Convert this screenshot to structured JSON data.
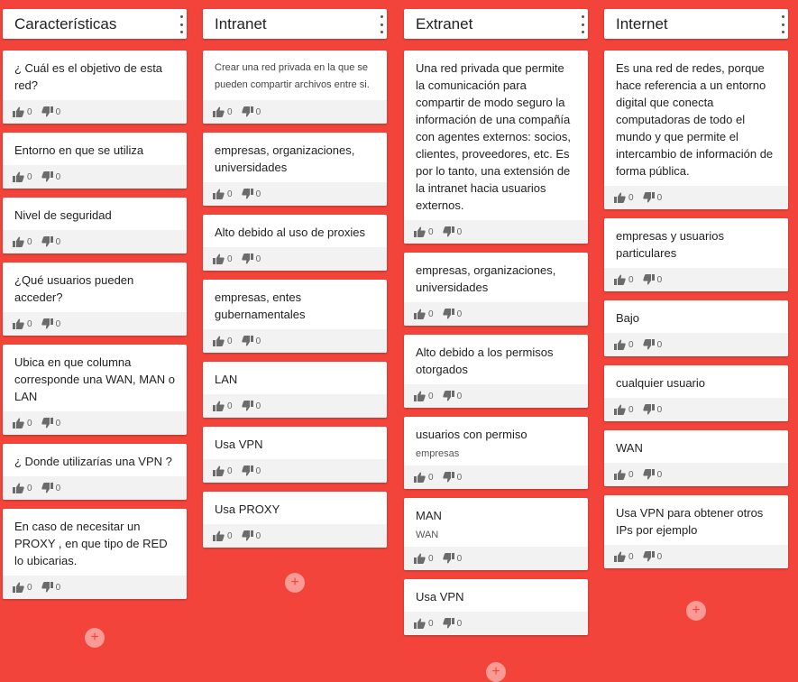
{
  "columns": [
    {
      "title": "Características",
      "cards": [
        {
          "text": "¿ Cuál es el objetivo de esta red?",
          "likes": "0",
          "dislikes": "0"
        },
        {
          "text": "Entorno en que se utiliza",
          "likes": "0",
          "dislikes": "0"
        },
        {
          "text": "Nivel de seguridad",
          "likes": "0",
          "dislikes": "0"
        },
        {
          "text": "¿Qué usuarios pueden acceder?",
          "likes": "0",
          "dislikes": "0"
        },
        {
          "text": "Ubica en que columna corresponde una WAN, MAN o LAN",
          "likes": "0",
          "dislikes": "0"
        },
        {
          "text": "¿ Donde utilizarías una VPN ?",
          "likes": "0",
          "dislikes": "0"
        },
        {
          "text": "En caso de necesitar un PROXY , en que tipo de RED lo ubicarias.",
          "likes": "0",
          "dislikes": "0"
        }
      ],
      "add_label": "+"
    },
    {
      "title": "Intranet",
      "cards": [
        {
          "text": "Crear una red privada en la que se pueden compartir archivos entre si.",
          "likes": "0",
          "dislikes": "0"
        },
        {
          "text": "empresas, organizaciones, universidades",
          "likes": "0",
          "dislikes": "0"
        },
        {
          "text": "Alto debido al uso de proxies",
          "likes": "0",
          "dislikes": "0"
        },
        {
          "text": "empresas, entes gubernamentales",
          "likes": "0",
          "dislikes": "0"
        },
        {
          "text": "LAN",
          "likes": "0",
          "dislikes": "0"
        },
        {
          "text": "Usa VPN",
          "likes": "0",
          "dislikes": "0"
        },
        {
          "text": "Usa PROXY",
          "likes": "0",
          "dislikes": "0"
        }
      ],
      "add_label": "+"
    },
    {
      "title": "Extranet",
      "cards": [
        {
          "text": "Una red privada que permite la comunicación para compartir de modo seguro la información de una compañía con agentes externos: socios, clientes, proveedores, etc. Es por lo tanto, una extensión de la intranet hacia usuarios externos.",
          "likes": "0",
          "dislikes": "0"
        },
        {
          "text": "empresas, organizaciones, universidades",
          "likes": "0",
          "dislikes": "0"
        },
        {
          "text": "Alto debido a los permisos otorgados",
          "likes": "0",
          "dislikes": "0"
        },
        {
          "text": "usuarios con permiso",
          "sub": "empresas",
          "likes": "0",
          "dislikes": "0"
        },
        {
          "text": "MAN",
          "sub": "WAN",
          "likes": "0",
          "dislikes": "0"
        },
        {
          "text": "Usa VPN",
          "likes": "0",
          "dislikes": "0"
        }
      ],
      "add_label": "+"
    },
    {
      "title": "Internet",
      "cards": [
        {
          "text": "Es una red de redes, porque hace referencia a un entorno digital que conecta computadoras de todo el mundo y que permite el intercambio de información de forma pública.",
          "likes": "0",
          "dislikes": "0"
        },
        {
          "text": "empresas y usuarios particulares",
          "likes": "0",
          "dislikes": "0"
        },
        {
          "text": "Bajo",
          "likes": "0",
          "dislikes": "0"
        },
        {
          "text": "cualquier usuario",
          "likes": "0",
          "dislikes": "0"
        },
        {
          "text": "WAN",
          "likes": "0",
          "dislikes": "0"
        },
        {
          "text": "Usa VPN para obtener otros IPs por ejemplo",
          "likes": "0",
          "dislikes": "0"
        }
      ],
      "add_label": "+"
    }
  ]
}
